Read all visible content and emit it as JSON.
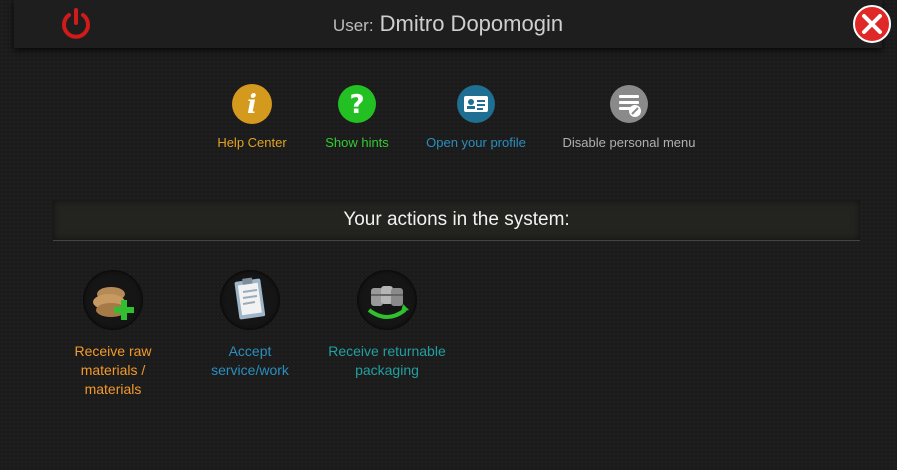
{
  "header": {
    "user_label": "User:",
    "user_name": "Dmitro Dopomogin"
  },
  "quick_links": [
    {
      "label": "Help Center",
      "icon": "info-icon",
      "color": "#e0a322"
    },
    {
      "label": "Show hints",
      "icon": "question-icon",
      "color": "#33cc33"
    },
    {
      "label": "Open your profile",
      "icon": "id-card-icon",
      "color": "#2a8fbf"
    },
    {
      "label": "Disable personal menu",
      "icon": "menu-off-icon",
      "color": "#aaaaaa"
    }
  ],
  "section": {
    "title": "Your actions in the system:"
  },
  "actions": [
    {
      "label": "Receive raw materials / materials",
      "icon": "sacks-plus-icon",
      "color": "#f39a2b"
    },
    {
      "label": "Accept service/work",
      "icon": "clipboard-icon",
      "color": "#2a8fbf"
    },
    {
      "label": "Receive returnable packaging",
      "icon": "kegs-return-icon",
      "color": "#20a0a0"
    }
  ],
  "colors": {
    "power": "#d11a1a",
    "close": "#e02828"
  }
}
